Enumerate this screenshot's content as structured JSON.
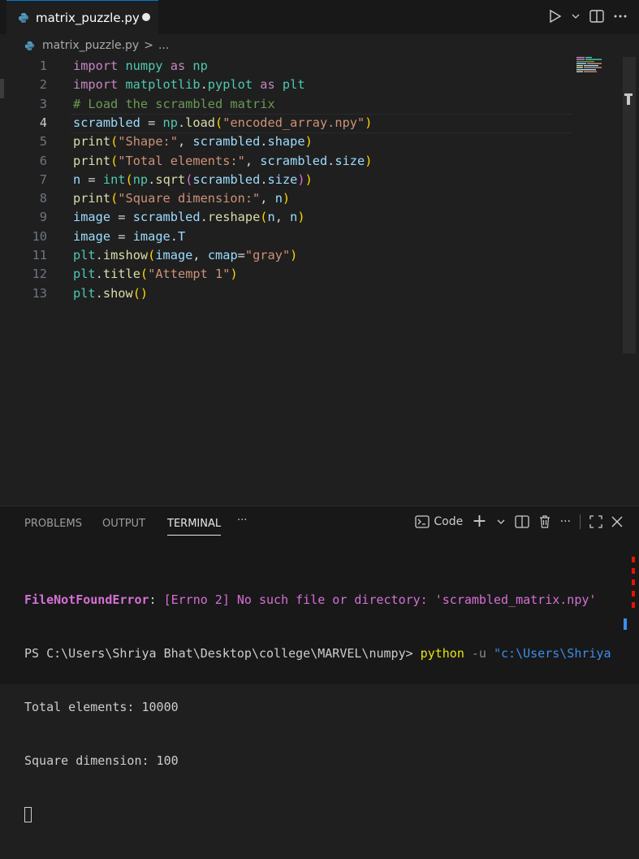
{
  "tab": {
    "filename": "matrix_puzzle.py"
  },
  "breadcrumb": {
    "file": "matrix_puzzle.py",
    "separator": ">",
    "more": "..."
  },
  "editor": {
    "active_line": 4,
    "lines": [
      {
        "n": "1",
        "tokens": [
          [
            "kw",
            "import "
          ],
          [
            "mo",
            "numpy"
          ],
          [
            "kw",
            " as "
          ],
          [
            "mo",
            "np"
          ]
        ]
      },
      {
        "n": "2",
        "tokens": [
          [
            "kw",
            "import "
          ],
          [
            "mo",
            "matplotlib"
          ],
          [
            "pl",
            "."
          ],
          [
            "mo",
            "pyplot"
          ],
          [
            "kw",
            " as "
          ],
          [
            "mo",
            "plt"
          ]
        ]
      },
      {
        "n": "3",
        "tokens": [
          [
            "cm",
            "# Load the scrambled matrix"
          ]
        ]
      },
      {
        "n": "4",
        "tokens": [
          [
            "va",
            "scrambled"
          ],
          [
            "pl",
            " = "
          ],
          [
            "mo",
            "np"
          ],
          [
            "pl",
            "."
          ],
          [
            "fn",
            "load"
          ],
          [
            "br",
            "("
          ],
          [
            "st",
            "\"encoded_array.npy\""
          ],
          [
            "br",
            ")"
          ]
        ]
      },
      {
        "n": "5",
        "tokens": [
          [
            "fn",
            "print"
          ],
          [
            "br",
            "("
          ],
          [
            "st",
            "\"Shape:\""
          ],
          [
            "pl",
            ", "
          ],
          [
            "va",
            "scrambled"
          ],
          [
            "pl",
            "."
          ],
          [
            "va",
            "shape"
          ],
          [
            "br",
            ")"
          ]
        ]
      },
      {
        "n": "6",
        "tokens": [
          [
            "fn",
            "print"
          ],
          [
            "br",
            "("
          ],
          [
            "st",
            "\"Total elements:\""
          ],
          [
            "pl",
            ", "
          ],
          [
            "va",
            "scrambled"
          ],
          [
            "pl",
            "."
          ],
          [
            "va",
            "size"
          ],
          [
            "br",
            ")"
          ]
        ]
      },
      {
        "n": "7",
        "tokens": [
          [
            "va",
            "n"
          ],
          [
            "pl",
            " = "
          ],
          [
            "mo",
            "int"
          ],
          [
            "br",
            "("
          ],
          [
            "mo",
            "np"
          ],
          [
            "pl",
            "."
          ],
          [
            "fn",
            "sqrt"
          ],
          [
            "br2",
            "("
          ],
          [
            "va",
            "scrambled"
          ],
          [
            "pl",
            "."
          ],
          [
            "va",
            "size"
          ],
          [
            "br2",
            ")"
          ],
          [
            "br",
            ")"
          ]
        ]
      },
      {
        "n": "8",
        "tokens": [
          [
            "fn",
            "print"
          ],
          [
            "br",
            "("
          ],
          [
            "st",
            "\"Square dimension:\""
          ],
          [
            "pl",
            ", "
          ],
          [
            "va",
            "n"
          ],
          [
            "br",
            ")"
          ]
        ]
      },
      {
        "n": "9",
        "tokens": [
          [
            "va",
            "image"
          ],
          [
            "pl",
            " = "
          ],
          [
            "va",
            "scrambled"
          ],
          [
            "pl",
            "."
          ],
          [
            "fn",
            "reshape"
          ],
          [
            "br",
            "("
          ],
          [
            "va",
            "n"
          ],
          [
            "pl",
            ", "
          ],
          [
            "va",
            "n"
          ],
          [
            "br",
            ")"
          ]
        ]
      },
      {
        "n": "10",
        "tokens": [
          [
            "va",
            "image"
          ],
          [
            "pl",
            " = "
          ],
          [
            "va",
            "image"
          ],
          [
            "pl",
            "."
          ],
          [
            "va",
            "T"
          ]
        ]
      },
      {
        "n": "11",
        "tokens": [
          [
            "mo",
            "plt"
          ],
          [
            "pl",
            "."
          ],
          [
            "fn",
            "imshow"
          ],
          [
            "br",
            "("
          ],
          [
            "va",
            "image"
          ],
          [
            "pl",
            ", "
          ],
          [
            "va",
            "cmap"
          ],
          [
            "pl",
            "="
          ],
          [
            "st",
            "\"gray\""
          ],
          [
            "br",
            ")"
          ]
        ]
      },
      {
        "n": "12",
        "tokens": [
          [
            "mo",
            "plt"
          ],
          [
            "pl",
            "."
          ],
          [
            "fn",
            "title"
          ],
          [
            "br",
            "("
          ],
          [
            "st",
            "\"Attempt 1\""
          ],
          [
            "br",
            ")"
          ]
        ]
      },
      {
        "n": "13",
        "tokens": [
          [
            "mo",
            "plt"
          ],
          [
            "pl",
            "."
          ],
          [
            "fn",
            "show"
          ],
          [
            "br",
            "()"
          ]
        ]
      }
    ]
  },
  "panel": {
    "tabs": [
      "PROBLEMS",
      "OUTPUT",
      "TERMINAL"
    ],
    "active_tab": "TERMINAL",
    "more": "···",
    "terminal_profile": "Code",
    "add_label": "+",
    "actions_more": "···"
  },
  "terminal": {
    "error_name": "FileNotFoundError",
    "error_colon": ": ",
    "error_message": "[Errno 2] No such file or directory: 'scrambled_matrix.npy'",
    "prompt": "PS C:\\Users\\Shriya Bhat\\Desktop\\college\\MARVEL\\numpy> ",
    "command": "python",
    "flag": " -u ",
    "arg": "\"c:\\Users\\Shriya",
    "output1": "Total elements: 10000",
    "output2": "Square dimension: 100"
  }
}
